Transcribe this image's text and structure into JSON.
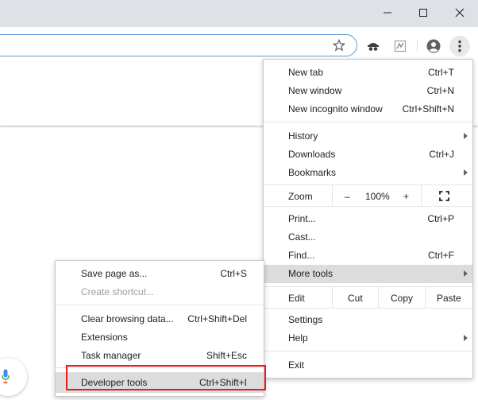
{
  "window": {
    "minimize_glyph": "—",
    "maximize_glyph": "☐",
    "close_glyph": "✕"
  },
  "toolbar": {
    "bookmark_icon": "star-icon",
    "extension_icons": [
      "spy-extension-icon",
      "tracker-extension-icon"
    ],
    "profile_icon": "account-circle-icon",
    "menu_icon": "three-dot-menu-icon"
  },
  "main_menu": {
    "group1": [
      {
        "label": "New tab",
        "shortcut": "Ctrl+T"
      },
      {
        "label": "New window",
        "shortcut": "Ctrl+N"
      },
      {
        "label": "New incognito window",
        "shortcut": "Ctrl+Shift+N"
      }
    ],
    "group2": [
      {
        "label": "History",
        "shortcut": ""
      },
      {
        "label": "Downloads",
        "shortcut": "Ctrl+J"
      },
      {
        "label": "Bookmarks",
        "shortcut": ""
      }
    ],
    "zoom": {
      "label": "Zoom",
      "minus": "–",
      "value": "100%",
      "plus": "+"
    },
    "group3": [
      {
        "label": "Print...",
        "shortcut": "Ctrl+P"
      },
      {
        "label": "Cast...",
        "shortcut": ""
      },
      {
        "label": "Find...",
        "shortcut": "Ctrl+F"
      },
      {
        "label": "More tools",
        "shortcut": ""
      }
    ],
    "edit": {
      "label": "Edit",
      "cut": "Cut",
      "copy": "Copy",
      "paste": "Paste"
    },
    "group4": [
      {
        "label": "Settings",
        "shortcut": ""
      },
      {
        "label": "Help",
        "shortcut": ""
      }
    ],
    "exit": {
      "label": "Exit"
    }
  },
  "submenu": {
    "group1": [
      {
        "label": "Save page as...",
        "shortcut": "Ctrl+S"
      },
      {
        "label": "Create shortcut...",
        "shortcut": ""
      }
    ],
    "group2": [
      {
        "label": "Clear browsing data...",
        "shortcut": "Ctrl+Shift+Del"
      },
      {
        "label": "Extensions",
        "shortcut": ""
      },
      {
        "label": "Task manager",
        "shortcut": "Shift+Esc"
      }
    ],
    "devtools": {
      "label": "Developer tools",
      "shortcut": "Ctrl+Shift+I"
    }
  },
  "colors": {
    "highlight": "#dcdcdc",
    "annotation_box": "#e81c1c",
    "omnibox_border": "#5b9bd5"
  }
}
